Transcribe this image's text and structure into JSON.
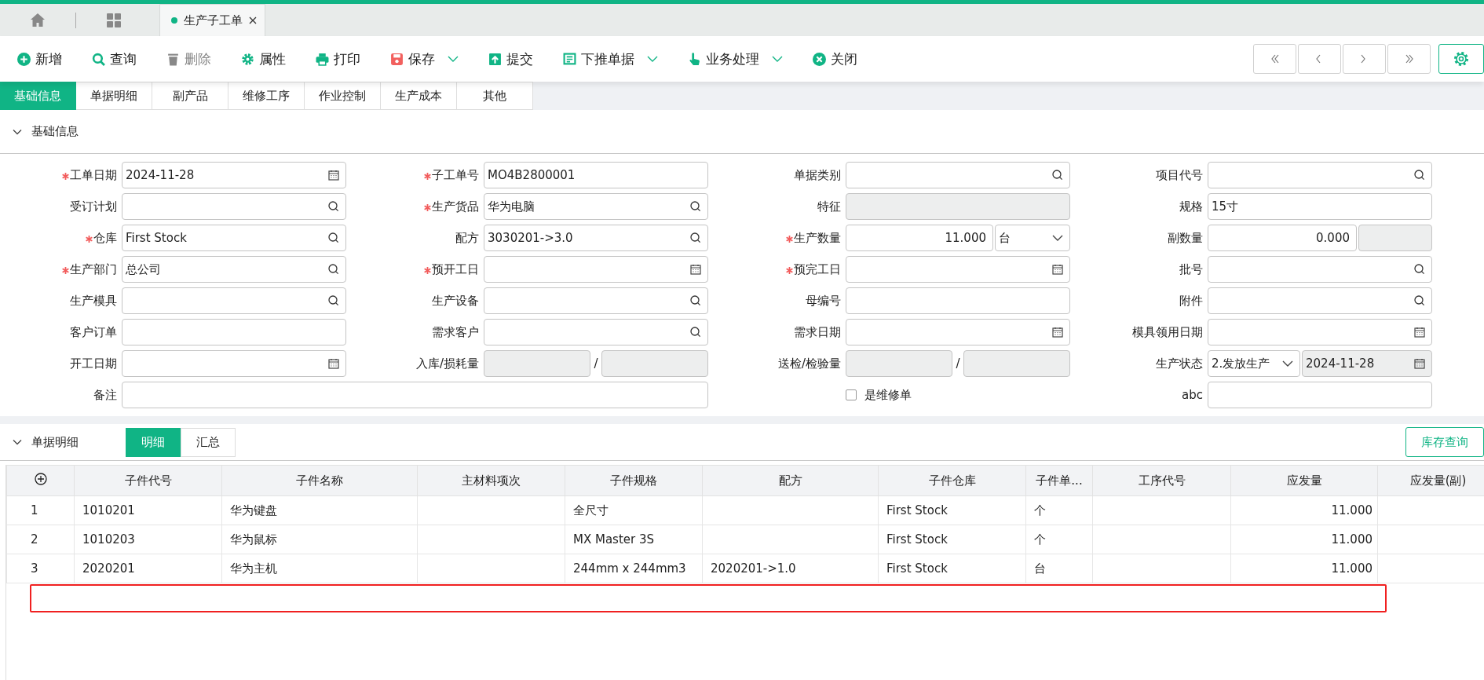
{
  "tab_bar": {
    "tabs": [
      {
        "label": "生产子工单",
        "selected": true
      }
    ]
  },
  "toolbar": {
    "buttons": [
      {
        "label": "新增",
        "kind": "plus",
        "disabled": false,
        "dropdown": false
      },
      {
        "label": "查询",
        "kind": "search",
        "disabled": false,
        "dropdown": false
      },
      {
        "label": "删除",
        "kind": "trash",
        "disabled": true,
        "dropdown": false
      },
      {
        "label": "属性",
        "kind": "gear",
        "disabled": false,
        "dropdown": false
      },
      {
        "label": "打印",
        "kind": "printer",
        "disabled": false,
        "dropdown": false
      },
      {
        "label": "保存",
        "kind": "save",
        "disabled": false,
        "dropdown": true
      },
      {
        "label": "提交",
        "kind": "upload",
        "disabled": false,
        "dropdown": false
      },
      {
        "label": "下推单据",
        "kind": "document",
        "disabled": false,
        "dropdown": true
      },
      {
        "label": "业务处理",
        "kind": "hand",
        "disabled": false,
        "dropdown": true
      },
      {
        "label": "关闭",
        "kind": "close",
        "disabled": false,
        "dropdown": false
      }
    ]
  },
  "sub_tabs": [
    {
      "label": "基础信息",
      "selected": true
    },
    {
      "label": "单据明细",
      "selected": false
    },
    {
      "label": "副产品",
      "selected": false
    },
    {
      "label": "维修工序",
      "selected": false
    },
    {
      "label": "作业控制",
      "selected": false
    },
    {
      "label": "生产成本",
      "selected": false
    },
    {
      "label": "其他",
      "selected": false
    }
  ],
  "basic_section": {
    "title": "基础信息",
    "expanded": true,
    "fields": [
      {
        "label": "工单日期",
        "required": true,
        "kind": "date",
        "value": "2024-11-28"
      },
      {
        "label": "子工单号",
        "required": true,
        "kind": "text",
        "value": "MO4B2800001"
      },
      {
        "label": "单据类别",
        "required": false,
        "kind": "lookup"
      },
      {
        "label": "项目代号",
        "required": false,
        "kind": "lookup"
      },
      {
        "label": "受订计划",
        "required": false,
        "kind": "lookup"
      },
      {
        "label": "生产货品",
        "required": true,
        "kind": "lookup",
        "value": "华为电脑"
      },
      {
        "label": "特征",
        "required": false,
        "kind": "readonly"
      },
      {
        "label": "规格",
        "required": false,
        "kind": "text",
        "value": "15寸"
      },
      {
        "label": "仓库",
        "required": true,
        "kind": "lookup",
        "value": "First Stock"
      },
      {
        "label": "配方",
        "required": false,
        "kind": "lookup",
        "value": "3030201->3.0"
      },
      {
        "label": "生产数量",
        "required": true,
        "kind": "number-unit",
        "value": "11.000",
        "unit": "台"
      },
      {
        "label": "副数量",
        "required": false,
        "kind": "number-extra",
        "value": "0.000"
      },
      {
        "label": "生产部门",
        "required": true,
        "kind": "lookup",
        "value": "总公司"
      },
      {
        "label": "预开工日",
        "required": true,
        "kind": "date"
      },
      {
        "label": "预完工日",
        "required": true,
        "kind": "date"
      },
      {
        "label": "批号",
        "required": false,
        "kind": "lookup"
      },
      {
        "label": "生产模具",
        "required": false,
        "kind": "lookup"
      },
      {
        "label": "生产设备",
        "required": false,
        "kind": "lookup"
      },
      {
        "label": "母编号",
        "required": false,
        "kind": "text"
      },
      {
        "label": "附件",
        "required": false,
        "kind": "lookup"
      },
      {
        "label": "客户订单",
        "required": false,
        "kind": "text"
      },
      {
        "label": "需求客户",
        "required": false,
        "kind": "lookup"
      },
      {
        "label": "需求日期",
        "required": false,
        "kind": "date"
      },
      {
        "label": "模具领用日期",
        "required": false,
        "kind": "date"
      },
      {
        "label": "开工日期",
        "required": false,
        "kind": "date"
      },
      {
        "label": "入库/损耗量",
        "required": false,
        "kind": "ratio",
        "separator": "/"
      },
      {
        "label": "送检/检验量",
        "required": false,
        "kind": "ratio",
        "separator": "/"
      },
      {
        "label": "生产状态",
        "required": false,
        "kind": "status-date",
        "value": "2.发放生产",
        "date": "2024-11-28"
      },
      {
        "label": "备注",
        "required": false,
        "kind": "wide-text"
      },
      {
        "label": "是维修单",
        "kind": "checkbox",
        "checked": false
      },
      {
        "label": "abc",
        "required": false,
        "kind": "text"
      }
    ]
  },
  "detail_section": {
    "title": "单据明细",
    "expanded": true,
    "view_tabs": [
      {
        "label": "明细",
        "selected": true
      },
      {
        "label": "汇总",
        "selected": false
      }
    ],
    "stock_button": "库存查询",
    "table": {
      "columns": [
        "子件代号",
        "子件名称",
        "主材料项次",
        "子件规格",
        "配方",
        "子件仓库",
        "子件单...",
        "工序代号",
        "应发量",
        "应发量(副)"
      ],
      "rows": [
        {
          "index": "1",
          "cells": [
            "1010201",
            "华为键盘",
            "",
            "全尺寸",
            "",
            "First Stock",
            "个",
            "",
            "11.000",
            ""
          ]
        },
        {
          "index": "2",
          "cells": [
            "1010203",
            "华为鼠标",
            "",
            "MX Master 3S",
            "",
            "First Stock",
            "个",
            "",
            "11.000",
            ""
          ]
        },
        {
          "index": "3",
          "cells": [
            "2020201",
            "华为主机",
            "",
            "244mm x 244mm3",
            "2020201->1.0",
            "First Stock",
            "台",
            "",
            "11.000",
            ""
          ]
        }
      ]
    }
  }
}
